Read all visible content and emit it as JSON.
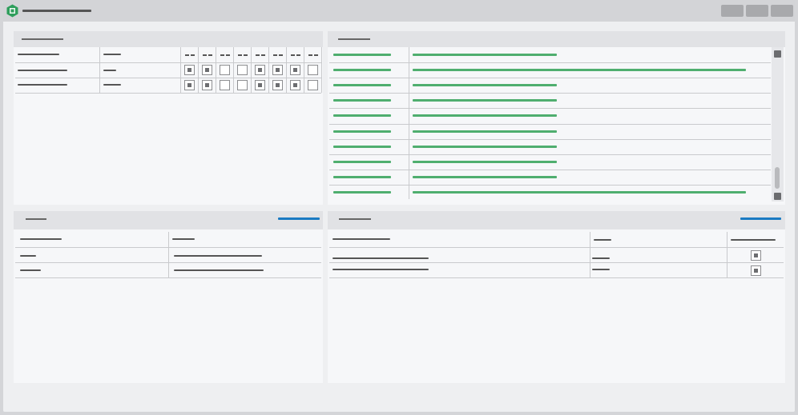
{
  "window": {
    "title": "",
    "icon": "app-logo-icon",
    "controls": [
      "minimize-button",
      "maximize-button",
      "close-button"
    ]
  },
  "colors": {
    "accent": "#1a7ac2",
    "link_green": "#4fae6f",
    "titlebar": "#d3d4d7",
    "panel_header": "#e1e2e5"
  },
  "panels": {
    "top_left": {
      "title": "",
      "columns": [
        "",
        ""
      ],
      "day_columns": 8,
      "rows": [
        {
          "name": "",
          "value": "",
          "checks": [
            true,
            true,
            false,
            false,
            true,
            true,
            true,
            false
          ]
        },
        {
          "name": "",
          "value": "",
          "checks": [
            true,
            true,
            false,
            false,
            true,
            true,
            true,
            false
          ]
        }
      ]
    },
    "top_right": {
      "title": "",
      "rows": 10,
      "scroll_position": 0.86
    },
    "bottom_left": {
      "title": "",
      "action_label": "",
      "columns": [
        "",
        ""
      ],
      "rows": [
        {
          "name": "",
          "value": ""
        },
        {
          "name": "",
          "value": ""
        }
      ]
    },
    "bottom_right": {
      "title": "",
      "action_label": "",
      "columns": [
        "",
        "",
        ""
      ],
      "rows": [
        {
          "name": "",
          "value": "",
          "checked": true
        },
        {
          "name": "",
          "value": "",
          "checked": true
        }
      ]
    }
  }
}
